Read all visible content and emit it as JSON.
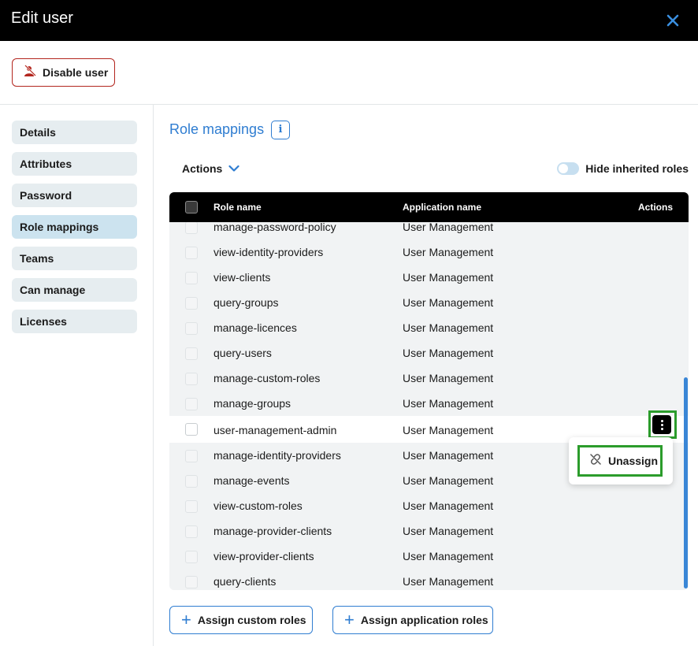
{
  "dialog": {
    "title": "Edit user"
  },
  "topbar": {
    "disable_label": "Disable user"
  },
  "sidebar": {
    "items": [
      {
        "label": "Details"
      },
      {
        "label": "Attributes"
      },
      {
        "label": "Password"
      },
      {
        "label": "Role mappings",
        "active": true
      },
      {
        "label": "Teams"
      },
      {
        "label": "Can manage"
      },
      {
        "label": "Licenses"
      }
    ]
  },
  "main": {
    "title": "Role mappings",
    "info_glyph": "i",
    "actions_label": "Actions",
    "toggle_label": "Hide inherited roles",
    "toggle_on": false,
    "table": {
      "headers": {
        "role": "Role name",
        "app": "Application name",
        "actions": "Actions"
      },
      "rows": [
        {
          "role": "manage-password-policy",
          "app": "User Management"
        },
        {
          "role": "view-identity-providers",
          "app": "User Management"
        },
        {
          "role": "view-clients",
          "app": "User Management"
        },
        {
          "role": "query-groups",
          "app": "User Management"
        },
        {
          "role": "manage-licences",
          "app": "User Management"
        },
        {
          "role": "query-users",
          "app": "User Management"
        },
        {
          "role": "manage-custom-roles",
          "app": "User Management"
        },
        {
          "role": "manage-groups",
          "app": "User Management"
        },
        {
          "role": "user-management-admin",
          "app": "User Management",
          "selected": true
        },
        {
          "role": "manage-identity-providers",
          "app": "User Management"
        },
        {
          "role": "manage-events",
          "app": "User Management"
        },
        {
          "role": "view-custom-roles",
          "app": "User Management"
        },
        {
          "role": "manage-provider-clients",
          "app": "User Management"
        },
        {
          "role": "view-provider-clients",
          "app": "User Management"
        },
        {
          "role": "query-clients",
          "app": "User Management"
        }
      ]
    },
    "row_menu": {
      "unassign_label": "Unassign"
    },
    "buttons": {
      "assign_custom": "Assign custom roles",
      "assign_application": "Assign application roles"
    }
  },
  "colors": {
    "accent": "#2f7dd1",
    "danger": "#b3261e",
    "highlight_box": "#2b9c2b"
  }
}
